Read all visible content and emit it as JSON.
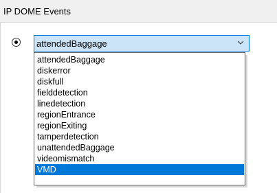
{
  "panel": {
    "title": "IP DOME Events"
  },
  "combo": {
    "value": "attendedBaggage"
  },
  "options": [
    "attendedBaggage",
    "diskerror",
    "diskfull",
    "fielddetection",
    "linedetection",
    "regionEntrance",
    "regionExiting",
    "tamperdetection",
    "unattendedBaggage",
    "videomismatch",
    "VMD"
  ],
  "highlighted_option": "VMD",
  "icons": {
    "chevron": "chevron-down-icon"
  }
}
